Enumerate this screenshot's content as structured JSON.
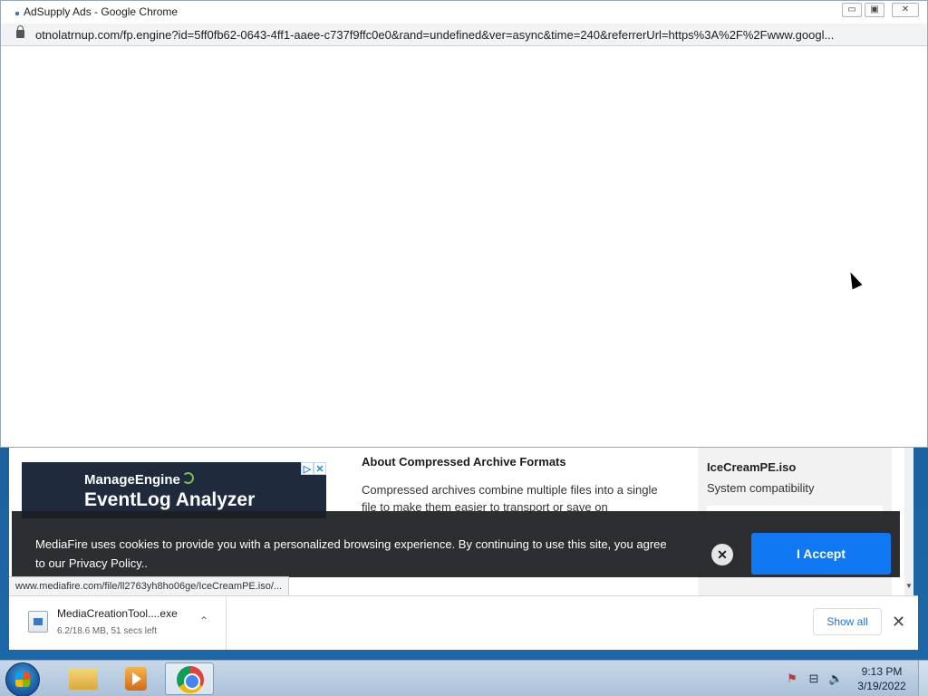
{
  "popup": {
    "title": "AdSupply Ads - Google Chrome",
    "url": "otnolatrnup.com/fp.engine?id=5ff0fb62-0643-4ff1-aaee-c737f9ffc0e0&rand=undefined&ver=async&time=240&referrerUrl=https%3A%2F%2Fwww.googl...",
    "buttons": {
      "minimize": "▭",
      "maximize": "▣",
      "close": "✕"
    }
  },
  "background_page": {
    "ad": {
      "brand": "ManageEngine",
      "product": "EventLog Analyzer",
      "badges": [
        "▷",
        "✕"
      ]
    },
    "about": {
      "title": "About Compressed Archive Formats",
      "text": "Compressed archives combine multiple files into a single file to make them easier to transport or save on"
    },
    "file": {
      "name": "IceCreamPE.iso",
      "compat": "System compatibility"
    },
    "scroll_arrow": "▼"
  },
  "cookie_banner": {
    "text": "MediaFire uses cookies to provide you with a personalized browsing experience. By continuing to use this site, you agree to our Privacy Policy..",
    "close": "✕",
    "accept": "I Accept"
  },
  "status_url": "www.mediafire.com/file/ll2763yh8ho06ge/IceCreamPE.iso/...",
  "download_shelf": {
    "item": {
      "name": "MediaCreationTool....exe",
      "status": "6.2/18.6 MB, 51 secs left",
      "chevron": "⌃"
    },
    "show_all": "Show all",
    "close": "✕"
  },
  "taskbar": {
    "tray": {
      "flag": "⚑",
      "network": "⊟",
      "volume": "🔈"
    },
    "clock": {
      "time": "9:13 PM",
      "date": "3/19/2022"
    }
  }
}
